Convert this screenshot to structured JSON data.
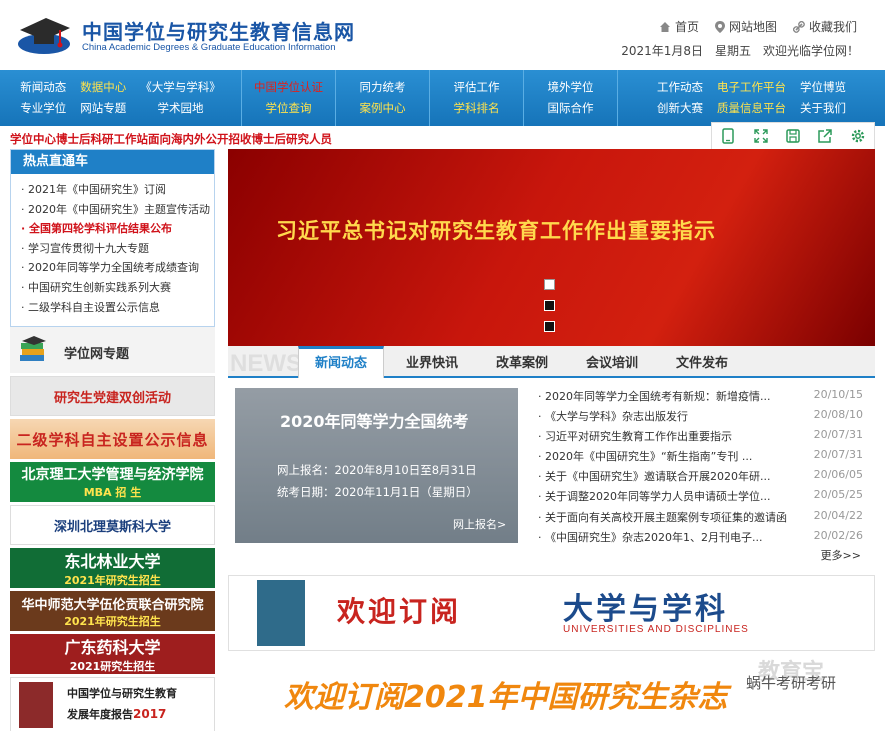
{
  "header": {
    "title": "中国学位与研究生教育信息网",
    "subtitle": "China Academic Degrees & Graduate Education Information",
    "links": [
      {
        "label": "首页",
        "icon": "home-icon"
      },
      {
        "label": "网站地图",
        "icon": "map-pin-icon"
      },
      {
        "label": "收藏我们",
        "icon": "link-icon"
      }
    ],
    "date": "2021年1月8日　星期五　欢迎光临学位网！"
  },
  "nav": {
    "groups": [
      [
        {
          "label": "新闻动态",
          "style": "white"
        },
        {
          "label": "数据中心",
          "style": "yellow"
        },
        {
          "label": "《大学与学科》",
          "style": "white"
        },
        {
          "label": "专业学位",
          "style": "white"
        },
        {
          "label": "网站专题",
          "style": "white"
        },
        {
          "label": "学术园地",
          "style": "white"
        }
      ],
      [
        {
          "label": "中国学位认证",
          "style": "red"
        },
        {
          "label": "学位查询",
          "style": "yellow"
        }
      ],
      [
        {
          "label": "同力统考",
          "style": "white"
        },
        {
          "label": "案例中心",
          "style": "yellow"
        }
      ],
      [
        {
          "label": "评估工作",
          "style": "white"
        },
        {
          "label": "学科排名",
          "style": "yellow"
        }
      ],
      [
        {
          "label": "境外学位",
          "style": "white"
        },
        {
          "label": "国际合作",
          "style": "white"
        }
      ],
      [
        {
          "label": "工作动态",
          "style": "white"
        },
        {
          "label": "电子工作平台",
          "style": "yellow"
        },
        {
          "label": "学位博览",
          "style": "white"
        },
        {
          "label": "创新大赛",
          "style": "white"
        },
        {
          "label": "质量信息平台",
          "style": "yellow"
        },
        {
          "label": "关于我们",
          "style": "white"
        }
      ]
    ]
  },
  "ticker": "学位中心博士后科研工作站面向海内外公开招收博士后研究人员",
  "toolbar": [
    "mobile-icon",
    "fullscreen-icon",
    "save-icon",
    "share-icon",
    "settings-icon"
  ],
  "hot": {
    "title": "热点直通车",
    "items": [
      {
        "text": "· 2021年《中国研究生》订阅",
        "hl": false
      },
      {
        "text": "· 2020年《中国研究生》主题宣传活动",
        "hl": false
      },
      {
        "text": "· 全国第四轮学科评估结果公布",
        "hl": true
      },
      {
        "text": "· 学习宣传贯彻十九大专题",
        "hl": false
      },
      {
        "text": "· 2020年同等学力全国统考成绩查询",
        "hl": false
      },
      {
        "text": "· 中国研究生创新实践系列大赛",
        "hl": false
      },
      {
        "text": "· 二级学科自主设置公示信息",
        "hl": false
      }
    ]
  },
  "topics": {
    "title": "学位网专题",
    "ads": [
      {
        "main": "研究生党建双创活动"
      },
      {
        "main": "二级学科自主设置公示信息"
      },
      {
        "main": "北京理工大学管理与经济学院",
        "sub": "MBA 招 生"
      },
      {
        "main": "深圳北理莫斯科大学"
      },
      {
        "main": "东北林业大学",
        "sub": "2021年研究生招生"
      },
      {
        "main": "华中师范大学伍伦贡联合研究院",
        "sub": "2021年研究生招生"
      },
      {
        "main": "广东药科大学",
        "sub": "2021研究生招生"
      },
      {
        "main": "中国学位与研究生教育",
        "sub": "发展年度报告",
        "year": "2017"
      }
    ]
  },
  "banner": {
    "text": "习近平总书记对研究生教育工作作出重要指示"
  },
  "news": {
    "watermark": "NEWS",
    "tabs": [
      "新闻动态",
      "业界快讯",
      "改革案例",
      "会议培训",
      "文件发布"
    ],
    "feature": {
      "title": "2020年同等学力全国统考",
      "line1": "网上报名：2020年8月10日至8月31日",
      "line2": "统考日期：2020年11月1日（星期日）",
      "button": "网上报名>"
    },
    "items": [
      {
        "title": "· 2020年同等学力全国统考有新规：新增疫情...",
        "date": "20/10/15"
      },
      {
        "title": "· 《大学与学科》杂志出版发行",
        "date": "20/08/10"
      },
      {
        "title": "· 习近平对研究生教育工作作出重要指示",
        "date": "20/07/31"
      },
      {
        "title": "· 2020年《中国研究生》“新生指南”专刊 ...",
        "date": "20/07/31"
      },
      {
        "title": "· 关于《中国研究生》邀请联合开展2020年研...",
        "date": "20/06/05"
      },
      {
        "title": "· 关于调整2020年同等学力人员申请硕士学位...",
        "date": "20/05/25"
      },
      {
        "title": "· 关于面向有关高校开展主题案例专项征集的邀请函",
        "date": "20/04/22"
      },
      {
        "title": "· 《中国研究生》杂志2020年1、2月刊电子...",
        "date": "20/02/26"
      }
    ],
    "more": "更多>>"
  },
  "sub_banner": {
    "welcome": "欢迎订阅",
    "magazine": "大学与学科",
    "english": "UNIVERSITIES AND DISCIPLINES"
  },
  "sub2": {
    "text": "欢迎订阅2021年中国研究生杂志",
    "watermark": "蜗牛考研考研",
    "watermark2": "教育宝"
  }
}
